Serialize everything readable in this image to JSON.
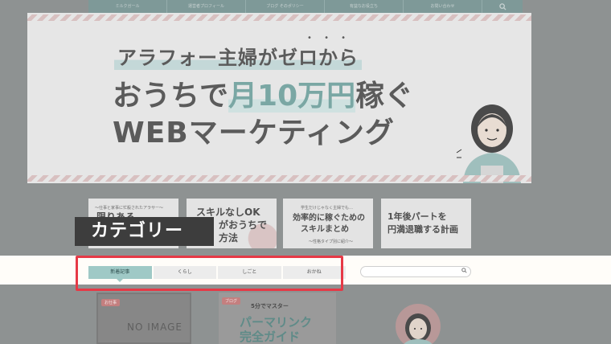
{
  "nav": {
    "items": [
      "ミルクガール",
      "運営者プロフィール",
      "ブログ そのポリシー",
      "有益なお役立ち",
      "お問い合わせ"
    ]
  },
  "hero": {
    "subtitle": "アラフォー主婦がゼロから",
    "line1_pre": "おうちで",
    "line1_highlight": "月10万円",
    "line1_post": "稼ぐ",
    "line2": "WEBマーケティング"
  },
  "cards": [
    {
      "small": "〜仕事と家事に忙殺されたアラサー〜",
      "title": "限りある",
      "title2": "",
      "sub": ""
    },
    {
      "small": "",
      "title": "スキルなしOK",
      "title2": "がおうちで",
      "title3": "方法",
      "sub": ""
    },
    {
      "small": "学生だけじゃなく主婦でも…",
      "title": "効率的に稼ぐための",
      "title2": "スキルまとめ",
      "sub": "〜性格タイプ別に紹介〜"
    },
    {
      "small": "",
      "title": "1年後パートを",
      "title2": "円満退職する計画",
      "sub": ""
    }
  ],
  "category_label": "カテゴリー",
  "tabs": [
    {
      "label": "新着記事",
      "active": true
    },
    {
      "label": "くらし",
      "active": false
    },
    {
      "label": "しごと",
      "active": false
    },
    {
      "label": "おかね",
      "active": false
    }
  ],
  "search": {
    "placeholder": ""
  },
  "posts": [
    {
      "badge": "お仕事",
      "noimage": "NO IMAGE"
    },
    {
      "badge": "ブログ",
      "line1": "5分でマスター",
      "title1": "パーマリンク",
      "title2": "完全ガイド"
    },
    {
      "badge": ""
    }
  ],
  "colors": {
    "accent": "#9fc9c6",
    "highlight_box": "#e63946",
    "label_bg": "#3d3d3d"
  }
}
